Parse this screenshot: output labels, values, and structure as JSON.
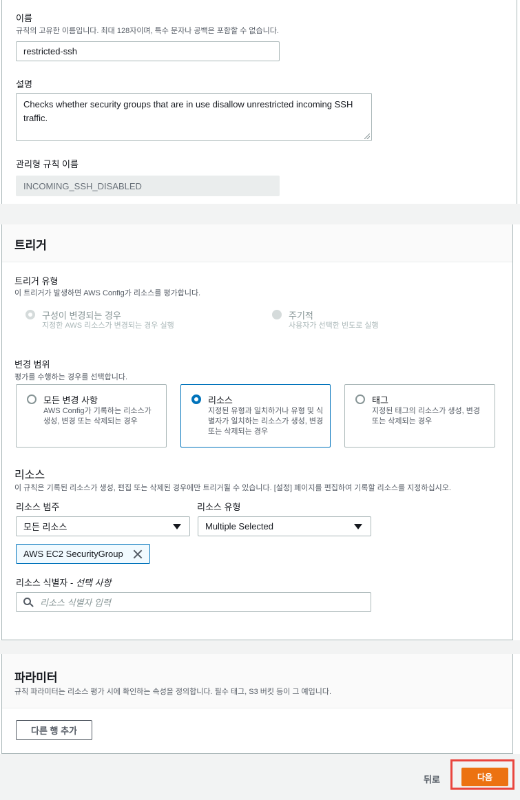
{
  "details": {
    "name_label": "이름",
    "name_desc": "규칙의 고유한 이름입니다. 최대 128자이며, 특수 문자나 공백은 포함할 수 없습니다.",
    "name_value": "restricted-ssh",
    "desc_label": "설명",
    "desc_value": "Checks whether security groups that are in use disallow unrestricted incoming SSH traffic.",
    "managed_label": "관리형 규칙 이름",
    "managed_value": "INCOMING_SSH_DISABLED"
  },
  "trigger": {
    "title": "트리거",
    "type_label": "트리거 유형",
    "type_desc": "이 트리거가 발생하면 AWS Config가 리소스를 평가합니다.",
    "type_options": [
      {
        "label": "구성이 변경되는 경우",
        "desc": "지정한 AWS 리소스가 변경되는 경우 실행",
        "state": "selected-disabled"
      },
      {
        "label": "주기적",
        "desc": "사용자가 선택한 빈도로 실행",
        "state": "disabled"
      }
    ],
    "scope_label": "변경 범위",
    "scope_desc": "평가를 수행하는 경우를 선택합니다.",
    "scope_options": [
      {
        "label": "모든 변경 사항",
        "desc": "AWS Config가 기록하는 리소스가 생성, 변경 또는 삭제되는 경우",
        "selected": false
      },
      {
        "label": "리소스",
        "desc": "지정된 유형과 일치하거나 유형 및 식별자가 일치하는 리소스가 생성, 변경 또는 삭제되는 경우",
        "selected": true
      },
      {
        "label": "태그",
        "desc": "지정된 태그의 리소스가 생성, 변경 또는 삭제되는 경우",
        "selected": false
      }
    ]
  },
  "resources": {
    "title": "리소스",
    "desc": "이 규칙은 기록된 리소스가 생성, 편집 또는 삭제된 경우에만 트리거될 수 있습니다. [설정] 페이지를 편집하여 기록할 리소스를 지정하십시오.",
    "category_label": "리소스 범주",
    "category_value": "모든 리소스",
    "type_label": "리소스 유형",
    "type_value": "Multiple Selected",
    "token": "AWS EC2 SecurityGroup",
    "identifier_label": "리소스 식별자 -",
    "identifier_optional": "선택 사항",
    "identifier_placeholder": "리소스 식별자 입력"
  },
  "parameters": {
    "title": "파라미터",
    "desc": "규칙 파라미터는 리소스 평가 시에 확인하는 속성을 정의합니다. 필수 태그, S3 버킷 등이 그 예입니다.",
    "add_row": "다른 행 추가"
  },
  "footer": {
    "back": "뒤로",
    "next": "다음"
  },
  "colors": {
    "primary": "#ec7211",
    "selected": "#0073bb",
    "highlight": "#e9453e"
  }
}
